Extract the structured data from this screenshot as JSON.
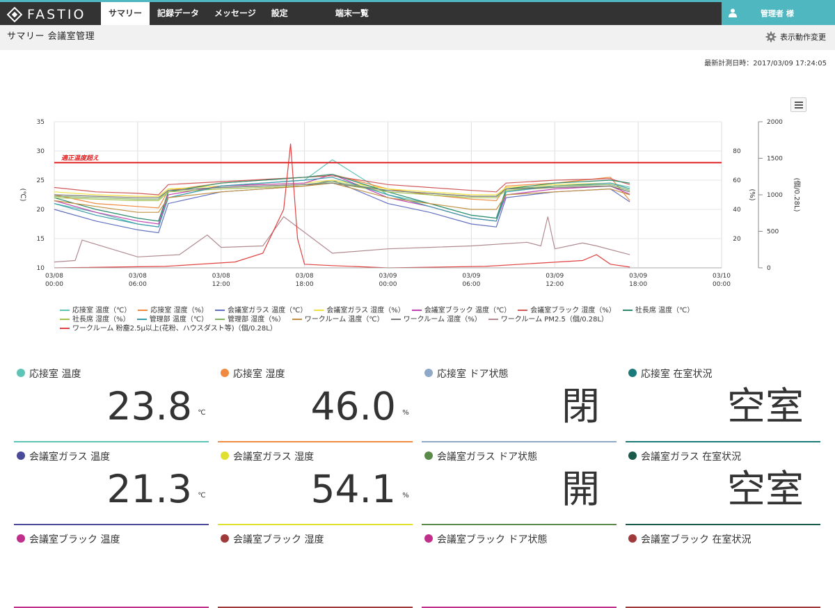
{
  "header": {
    "logo_text": "FASTIO",
    "nav": [
      "サマリー",
      "記録データ",
      "メッセージ",
      "設定",
      "端末一覧"
    ],
    "user_name": "管理者 様",
    "accent_color": "#4fb7c0"
  },
  "subbar": {
    "page_title": "サマリー  会議室管理",
    "display_change_label": "表示動作変更"
  },
  "last_measured": "最新計測日時：2017/03/09 17:24:05",
  "chart_data": {
    "type": "line",
    "x_axis": {
      "ticks": [
        "03/08 00:00",
        "03/08 06:00",
        "03/08 12:00",
        "03/08 18:00",
        "03/09 00:00",
        "03/09 06:00",
        "03/09 12:00",
        "03/09 18:00",
        "03/10 00:00"
      ],
      "range_hours": [
        0,
        48
      ]
    },
    "y_axes": [
      {
        "side": "left",
        "label": "(℃)",
        "range": [
          10,
          35
        ],
        "ticks": [
          10,
          15,
          20,
          25,
          30,
          35
        ]
      },
      {
        "side": "right",
        "label": "(%)",
        "range": [
          0,
          100
        ],
        "ticks": [
          20,
          40,
          60,
          80
        ]
      },
      {
        "side": "right",
        "label": "(個/0.28L)",
        "range": [
          0,
          2000
        ],
        "ticks": [
          0,
          500,
          1000,
          1500,
          2000
        ]
      }
    ],
    "threshold": {
      "value": 28,
      "axis": "left",
      "label": "適正温度超え",
      "color": "#e02020"
    },
    "grid": true,
    "legend_position": "bottom",
    "series": [
      {
        "name": "応接室 温度（℃）",
        "axis": "left",
        "color": "#5ec4b6",
        "x": [
          0,
          3,
          6,
          7.5,
          8.2,
          12,
          18,
          20,
          24,
          27,
          30,
          31.8,
          32.5,
          36,
          40,
          41.4
        ],
        "y": [
          21,
          19.5,
          17.5,
          17,
          22,
          24,
          25,
          28.5,
          22.5,
          21,
          19,
          18.5,
          23,
          24,
          24.5,
          23.8
        ]
      },
      {
        "name": "応接室 湿度（%）",
        "axis": "mid",
        "color": "#f08a40",
        "x": [
          0,
          3,
          6,
          7.5,
          8.2,
          12,
          18,
          20,
          24,
          27,
          30,
          31.8,
          32.5,
          36,
          40,
          41.4
        ],
        "y": [
          50,
          44,
          42,
          41,
          53,
          58,
          62,
          64,
          54,
          50,
          47,
          46,
          56,
          58,
          62,
          46
        ]
      },
      {
        "name": "会議室ガラス 温度（℃）",
        "axis": "left",
        "color": "#6070c0",
        "x": [
          0,
          3,
          6,
          7.5,
          8.2,
          12,
          18,
          20,
          24,
          27,
          30,
          31.8,
          32.5,
          36,
          40,
          41.4
        ],
        "y": [
          20,
          18,
          16.5,
          16,
          21,
          23,
          24,
          25,
          21,
          19.5,
          17.5,
          17,
          22,
          23,
          23.5,
          21.3
        ]
      },
      {
        "name": "会議室ガラス 湿度（%）",
        "axis": "mid",
        "color": "#f0e040",
        "x": [
          0,
          3,
          6,
          7.5,
          8.2,
          12,
          18,
          20,
          24,
          27,
          30,
          31.8,
          32.5,
          36,
          40,
          41.4
        ],
        "y": [
          52,
          50,
          49,
          49,
          54,
          56,
          58,
          60,
          54,
          52,
          50,
          50,
          55,
          57,
          58,
          54.1
        ]
      },
      {
        "name": "会議室ブラック 温度（℃）",
        "axis": "left",
        "color": "#c040b0",
        "x": [
          0,
          3,
          6,
          7.5,
          8.2,
          12,
          18,
          20,
          24,
          27,
          30,
          31.8,
          32.5,
          36,
          40,
          41.4
        ],
        "y": [
          21.5,
          19.5,
          18,
          17.5,
          22.5,
          24,
          24.5,
          26,
          22,
          20.5,
          18.5,
          18,
          22.5,
          23.5,
          24,
          22.6
        ]
      },
      {
        "name": "会議室ブラック 湿度（%）",
        "axis": "mid",
        "color": "#d05858",
        "x": [
          0,
          3,
          6,
          7.5,
          8.2,
          12,
          18,
          20,
          24,
          27,
          30,
          31.8,
          32.5,
          36,
          40,
          41.4
        ],
        "y": [
          55,
          52,
          51,
          50,
          57,
          59,
          62,
          63,
          57,
          55,
          53,
          52,
          58,
          60,
          61,
          57
        ]
      },
      {
        "name": "社長席 温度（℃）",
        "axis": "left",
        "color": "#2a8a6a",
        "x": [
          0,
          3,
          6,
          7.5,
          8.2,
          12,
          18,
          20,
          24,
          27,
          30,
          31.8,
          32.5,
          36,
          40,
          41.4
        ],
        "y": [
          22,
          20,
          18.5,
          18,
          23,
          24.5,
          25.5,
          26,
          23,
          21,
          19,
          18.5,
          23.5,
          24.5,
          25,
          24.5
        ]
      },
      {
        "name": "社長席 湿度（%）",
        "axis": "mid",
        "color": "#a0c050",
        "x": [
          0,
          3,
          6,
          7.5,
          8.2,
          12,
          18,
          20,
          24,
          27,
          30,
          31.8,
          32.5,
          36,
          40,
          41.4
        ],
        "y": [
          48,
          47,
          46,
          46,
          52,
          54,
          56,
          58,
          52,
          50,
          48,
          48,
          53,
          55,
          56,
          52
        ]
      },
      {
        "name": "管理部 温度（℃）",
        "axis": "left",
        "color": "#3a9aaa",
        "x": [
          0,
          3,
          6,
          7.5,
          8.2,
          12,
          18,
          20,
          24,
          27,
          30,
          31.8,
          32.5,
          36,
          40,
          41.4
        ],
        "y": [
          21,
          19,
          17.5,
          17,
          22,
          24,
          25,
          25.5,
          22.5,
          20.5,
          18.5,
          18,
          23,
          24,
          24.5,
          23.5
        ]
      },
      {
        "name": "管理部 湿度（%）",
        "axis": "mid",
        "color": "#80b060",
        "x": [
          0,
          3,
          6,
          7.5,
          8.2,
          12,
          18,
          20,
          24,
          27,
          30,
          31.8,
          32.5,
          36,
          40,
          41.4
        ],
        "y": [
          49,
          48,
          47,
          47,
          53,
          55,
          57,
          59,
          53,
          51,
          49,
          49,
          54,
          56,
          57,
          53
        ]
      },
      {
        "name": "ワークルーム 温度（℃）",
        "axis": "left",
        "color": "#c09040",
        "x": [
          0,
          3,
          6,
          7.5,
          8.2,
          12,
          18,
          20,
          24,
          27,
          30,
          31.8,
          32.5,
          36,
          40,
          41.4
        ],
        "y": [
          21.5,
          20.5,
          19.5,
          19.5,
          22,
          23,
          24,
          24.5,
          22,
          21,
          20,
          20,
          22.5,
          23,
          23.5,
          22.5
        ]
      },
      {
        "name": "ワークルーム 湿度（%）",
        "axis": "mid",
        "color": "#7a7a7a",
        "x": [
          0,
          3,
          6,
          7.5,
          8.2,
          12,
          18,
          20,
          24,
          27,
          30,
          31.8,
          32.5,
          36,
          40,
          41.4
        ],
        "y": [
          50,
          49,
          48,
          48,
          53,
          55,
          57,
          58,
          53,
          51,
          49,
          49,
          54,
          55,
          56,
          52
        ]
      },
      {
        "name": "ワークルーム PM2.5（個/0.28L）",
        "axis": "right",
        "color": "#b08a90",
        "x": [
          0,
          1.5,
          2,
          6,
          9,
          11,
          12,
          15,
          16.5,
          20,
          24,
          27,
          30,
          34,
          35,
          35.5,
          36,
          38,
          39,
          41.4
        ],
        "y": [
          80,
          100,
          380,
          150,
          180,
          450,
          280,
          300,
          700,
          200,
          260,
          280,
          300,
          350,
          300,
          700,
          260,
          340,
          300,
          180
        ]
      },
      {
        "name": "ワークルーム 粉塵2.5μ以上(花粉、ハウスダスト等)（個/0.28L）",
        "axis": "right",
        "color": "#e04040",
        "x": [
          0,
          8,
          13,
          15,
          16.5,
          17,
          17.5,
          18,
          20,
          24,
          31,
          38,
          39,
          40,
          41.4
        ],
        "y": [
          0,
          20,
          80,
          200,
          800,
          1700,
          400,
          50,
          30,
          0,
          20,
          100,
          180,
          50,
          10
        ]
      }
    ]
  },
  "cards": [
    {
      "title": "応接室 温度",
      "value": "23.8",
      "unit": "℃",
      "color": "#5ec4b6"
    },
    {
      "title": "応接室 湿度",
      "value": "46.0",
      "unit": "%",
      "color": "#f08a40"
    },
    {
      "title": "応接室 ドア状態",
      "value": "閉",
      "unit": "",
      "color": "#8fa8c8"
    },
    {
      "title": "応接室 在室状況",
      "value": "空室",
      "unit": "",
      "color": "#1a7a7a"
    },
    {
      "title": "会議室ガラス 温度",
      "value": "21.3",
      "unit": "℃",
      "color": "#4a4a9a"
    },
    {
      "title": "会議室ガラス 湿度",
      "value": "54.1",
      "unit": "%",
      "color": "#e0e030"
    },
    {
      "title": "会議室ガラス ドア状態",
      "value": "開",
      "unit": "",
      "color": "#5a8a4a"
    },
    {
      "title": "会議室ガラス 在室状況",
      "value": "空室",
      "unit": "",
      "color": "#1a5a4a"
    },
    {
      "title": "会議室ブラック 温度",
      "value": "",
      "unit": "",
      "color": "#c0308a"
    },
    {
      "title": "会議室ブラック 湿度",
      "value": "",
      "unit": "",
      "color": "#a03a3a"
    },
    {
      "title": "会議室ブラック ドア状態",
      "value": "",
      "unit": "",
      "color": "#c0308a"
    },
    {
      "title": "会議室ブラック 在室状況",
      "value": "",
      "unit": "",
      "color": "#a03a3a"
    }
  ]
}
